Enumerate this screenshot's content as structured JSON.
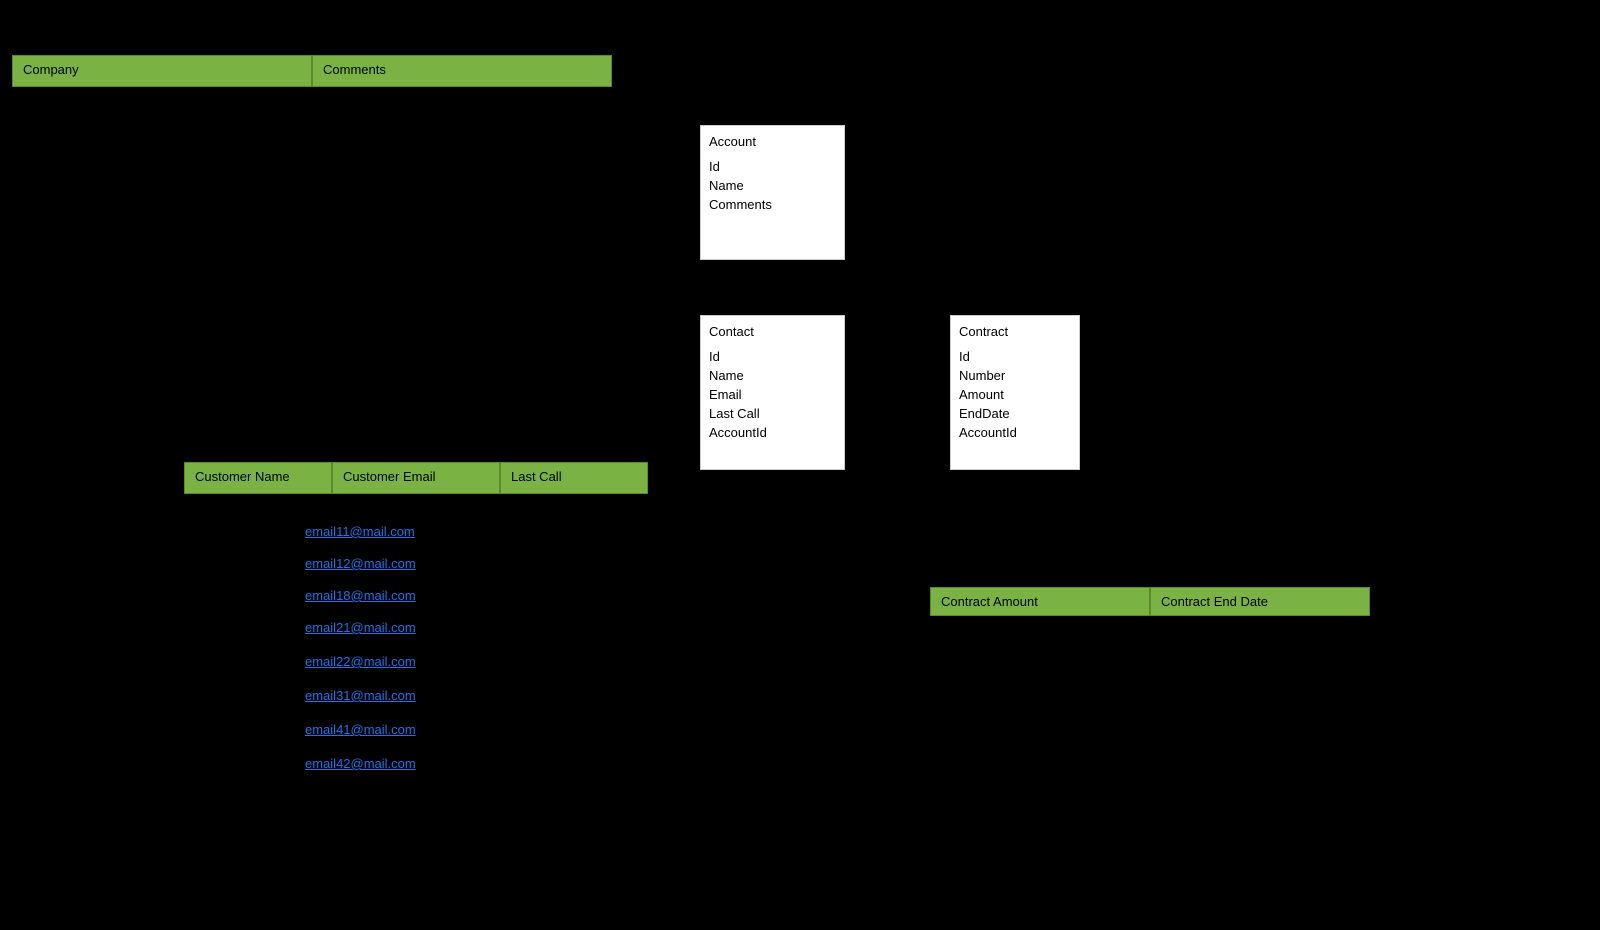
{
  "account_table": {
    "col1": "Company",
    "col2": "Comments"
  },
  "account_entity": {
    "title": "Account",
    "fields": [
      "Id",
      "Name",
      "Comments"
    ]
  },
  "contact_entity": {
    "title": "Contact",
    "fields": [
      "Id",
      "Name",
      "Email",
      "Last Call",
      "AccountId"
    ]
  },
  "contract_entity": {
    "title": "Contract",
    "fields": [
      "Id",
      "Number",
      "Amount",
      "EndDate",
      "AccountId"
    ]
  },
  "contact_table": {
    "col1": "Customer Name",
    "col2": "Customer Email",
    "col3": "Last Call"
  },
  "contract_table": {
    "col1": "Contract Amount",
    "col2": "Contract End Date"
  },
  "emails": [
    "email11@mail.com",
    "email12@mail.com",
    "email18@mail.com",
    "email21@mail.com",
    "email22@mail.com",
    "email31@mail.com",
    "email41@mail.com",
    "email42@mail.com"
  ]
}
